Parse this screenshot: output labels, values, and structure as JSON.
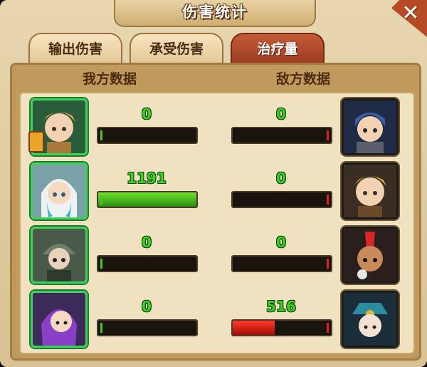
{
  "window": {
    "title": "伤害统计",
    "close_icon": "close-icon"
  },
  "tabs": [
    {
      "label": "输出伤害",
      "active": false
    },
    {
      "label": "承受伤害",
      "active": false
    },
    {
      "label": "治疗量",
      "active": true
    }
  ],
  "headers": {
    "ally": "我方数据",
    "enemy": "敌方数据"
  },
  "colors": {
    "ally_value": "#3bd21f",
    "ally_bar": "#4fc423",
    "enemy_bar": "#e0201a",
    "active_tab": "#b0472a"
  },
  "rows": [
    {
      "ally": {
        "value": "0",
        "fill": 0.0,
        "hero": "blonde-knight"
      },
      "enemy": {
        "value": "0",
        "fill": 0.0,
        "hero": "armored-knight"
      }
    },
    {
      "ally": {
        "value": "1191",
        "fill": 1.0,
        "hero": "white-priestess"
      },
      "enemy": {
        "value": "0",
        "fill": 0.0,
        "hero": "blonde-knight"
      }
    },
    {
      "ally": {
        "value": "0",
        "fill": 0.0,
        "hero": "helmeted-soldier"
      },
      "enemy": {
        "value": "0",
        "fill": 0.0,
        "hero": "mohawk-warrior"
      }
    },
    {
      "ally": {
        "value": "0",
        "fill": 0.0,
        "hero": "purple-mage"
      },
      "enemy": {
        "value": "516",
        "fill": 0.43,
        "hero": "captain"
      }
    }
  ]
}
